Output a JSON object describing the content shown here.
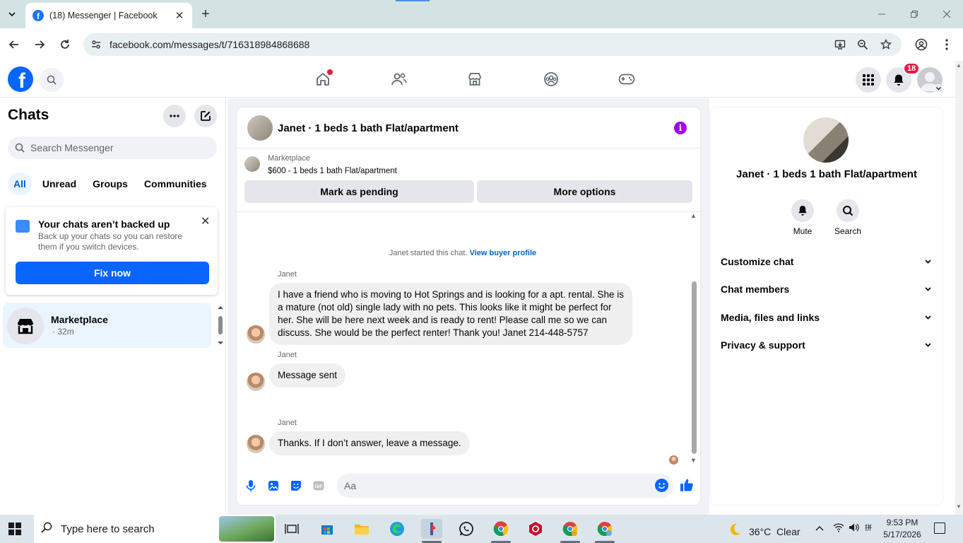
{
  "browser": {
    "tab_title": "(18) Messenger | Facebook",
    "url": "facebook.com/messages/t/716318984868688",
    "colors": {
      "tabbar": "#d3e3e4",
      "omnibox": "#e8f0f1"
    }
  },
  "fb_nav": {
    "notification_count": "18",
    "brand_color": "#0866ff",
    "icons": [
      "home-icon",
      "friends-icon",
      "marketplace-icon",
      "groups-icon",
      "gaming-icon"
    ]
  },
  "chats": {
    "heading": "Chats",
    "search_placeholder": "Search Messenger",
    "filters": [
      "All",
      "Unread",
      "Groups",
      "Communities"
    ],
    "backup": {
      "title": "Your chats aren’t backed up",
      "description": "Back up your chats so you can restore them if you switch devices.",
      "button": "Fix now"
    },
    "conversations": [
      {
        "name": "Marketplace",
        "time": "· 32m"
      }
    ]
  },
  "conversation": {
    "title": "Janet · 1 beds 1 bath Flat/apartment",
    "marketplace": {
      "label": "Marketplace",
      "listing": "$600 - 1 beds 1 bath Flat/apartment",
      "pending_button": "Mark as pending",
      "options_button": "More options"
    },
    "system_text": "Janet started this chat.",
    "system_link": "View buyer profile",
    "messages": [
      {
        "sender": "Janet",
        "text": "I have a friend who is moving to Hot Springs and is looking for a apt. rental. She is a mature (not old) single lady with no pets. This looks like it might be perfect for her. She will be here next week and is ready to rent! Please call me so we can discuss. She would be the perfect renter! Thank you! Janet 214-448-5757"
      },
      {
        "sender": "Janet",
        "text": "Message sent"
      },
      {
        "sender": "Janet",
        "text": "Thanks. If I don’t answer, leave a message."
      }
    ],
    "composer_placeholder": "Aa",
    "accent_color": "#0866ff"
  },
  "details": {
    "name": "Janet · 1 beds 1 bath Flat/apartment",
    "actions": [
      "Mute",
      "Search"
    ],
    "sections": [
      "Customize chat",
      "Chat members",
      "Media, files and links",
      "Privacy & support"
    ]
  },
  "taskbar": {
    "search_placeholder": "Type here to search",
    "weather": "36°C  Clear",
    "time": "9:53 PM",
    "date": "5/17/2026"
  }
}
